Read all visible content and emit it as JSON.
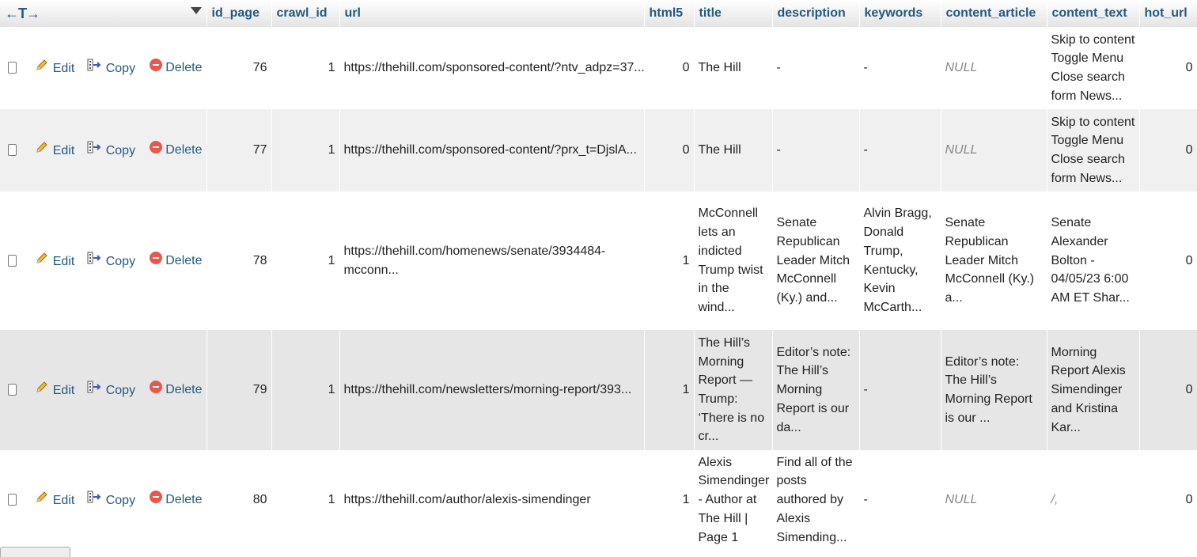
{
  "header": {
    "arrows": "←T→",
    "columns": [
      "id_page",
      "crawl_id",
      "url",
      "html5",
      "title",
      "description",
      "keywords",
      "content_article",
      "content_text",
      "hot_url"
    ]
  },
  "actions": {
    "edit": "Edit",
    "copy": "Copy",
    "delete": "Delete"
  },
  "rows": [
    {
      "id_page": "76",
      "crawl_id": "1",
      "url": "https://thehill.com/sponsored-content/?ntv_adpz=37...",
      "html5": "0",
      "title": "The Hill",
      "description": "-",
      "keywords": "-",
      "content_article": "NULL",
      "content_text": "Skip to content Toggle Menu Close search form News...",
      "hot_url": "0"
    },
    {
      "id_page": "77",
      "crawl_id": "1",
      "url": "https://thehill.com/sponsored-content/?prx_t=DjslA...",
      "html5": "0",
      "title": "The Hill",
      "description": "-",
      "keywords": "-",
      "content_article": "NULL",
      "content_text": "Skip to content Toggle Menu Close search form News...",
      "hot_url": "0"
    },
    {
      "id_page": "78",
      "crawl_id": "1",
      "url": "https://thehill.com/homenews/senate/3934484-mcconn...",
      "html5": "1",
      "title": "McConnell lets an indicted Trump twist in the wind...",
      "description": "Senate Republican Leader Mitch McConnell (Ky.) and...",
      "keywords": "Alvin Bragg, Donald Trump, Kentucky, Kevin McCarth...",
      "content_article": "Senate Republican Leader Mitch McConnell (Ky.) a...",
      "content_text": "Senate Alexander Bolton - 04/05/23 6:00 AM ET Shar...",
      "hot_url": "0"
    },
    {
      "id_page": "79",
      "crawl_id": "1",
      "url": "https://thehill.com/newsletters/morning-report/393...",
      "html5": "1",
      "title": "The Hill’s Morning Report — Trump: ‘There is no cr...",
      "description": "Editor’s note: The Hill’s Morning Report is our da...",
      "keywords": "-",
      "content_article": "Editor’s note: The Hill’s Morning Report is our ...",
      "content_text": "Morning Report Alexis Simendinger and Kristina Kar...",
      "hot_url": "0"
    },
    {
      "id_page": "80",
      "crawl_id": "1",
      "url": "https://thehill.com/author/alexis-simendinger",
      "html5": "1",
      "title": "Alexis Simendinger - Author at The Hill | Page 1",
      "description": "Find all of the posts authored by Alexis Simending...",
      "keywords": "-",
      "content_article": "NULL",
      "content_text": "/,",
      "hot_url": "0"
    }
  ]
}
